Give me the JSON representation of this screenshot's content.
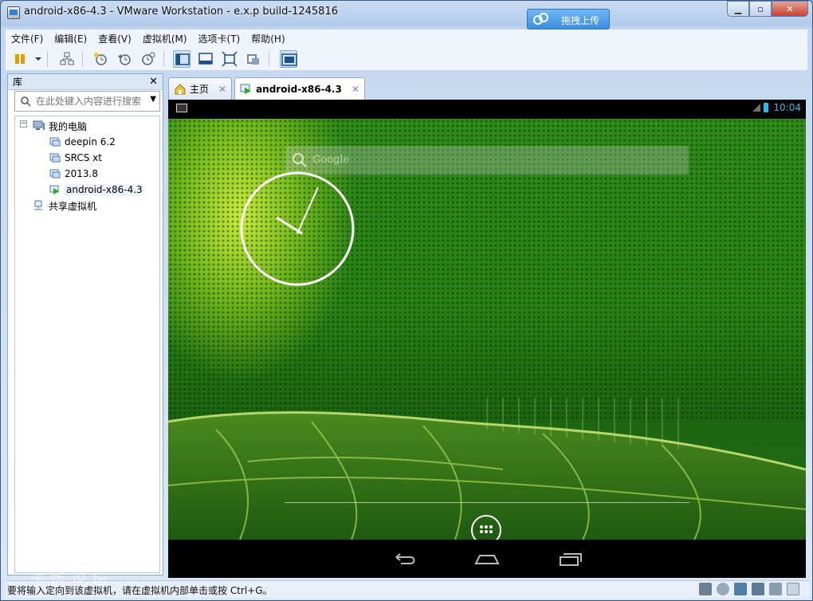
{
  "window": {
    "title": "android-x86-4.3 - VMware Workstation - e.x.p build-1245816",
    "upload_label": "拖拽上传"
  },
  "menu": [
    {
      "label": "文件(F)"
    },
    {
      "label": "编辑(E)"
    },
    {
      "label": "查看(V)"
    },
    {
      "label": "虚拟机(M)"
    },
    {
      "label": "选项卡(T)"
    },
    {
      "label": "帮助(H)"
    }
  ],
  "library": {
    "title": "库",
    "search_placeholder": "在此处键入内容进行搜索",
    "tree": {
      "root": "我的电脑",
      "vms": [
        "deepin 6.2",
        "SRCS xt",
        "2013.8",
        "android-x86-4.3"
      ],
      "shared": "共享虚拟机"
    }
  },
  "tabs": [
    {
      "label": "主页",
      "icon": "home-icon"
    },
    {
      "label": "android-x86-4.3",
      "icon": "vm-running-icon",
      "active": true
    }
  ],
  "android": {
    "time": "10:04",
    "search_hint": "Google"
  },
  "statusbar": {
    "message": "要将输入定向到该虚拟机，请在虚拟机内部单击或按 Ctrl+G。",
    "watermark": "卡饭论坛"
  },
  "colors": {
    "holo_blue": "#33b5e5",
    "wallpaper_green": "#2a7f15"
  }
}
